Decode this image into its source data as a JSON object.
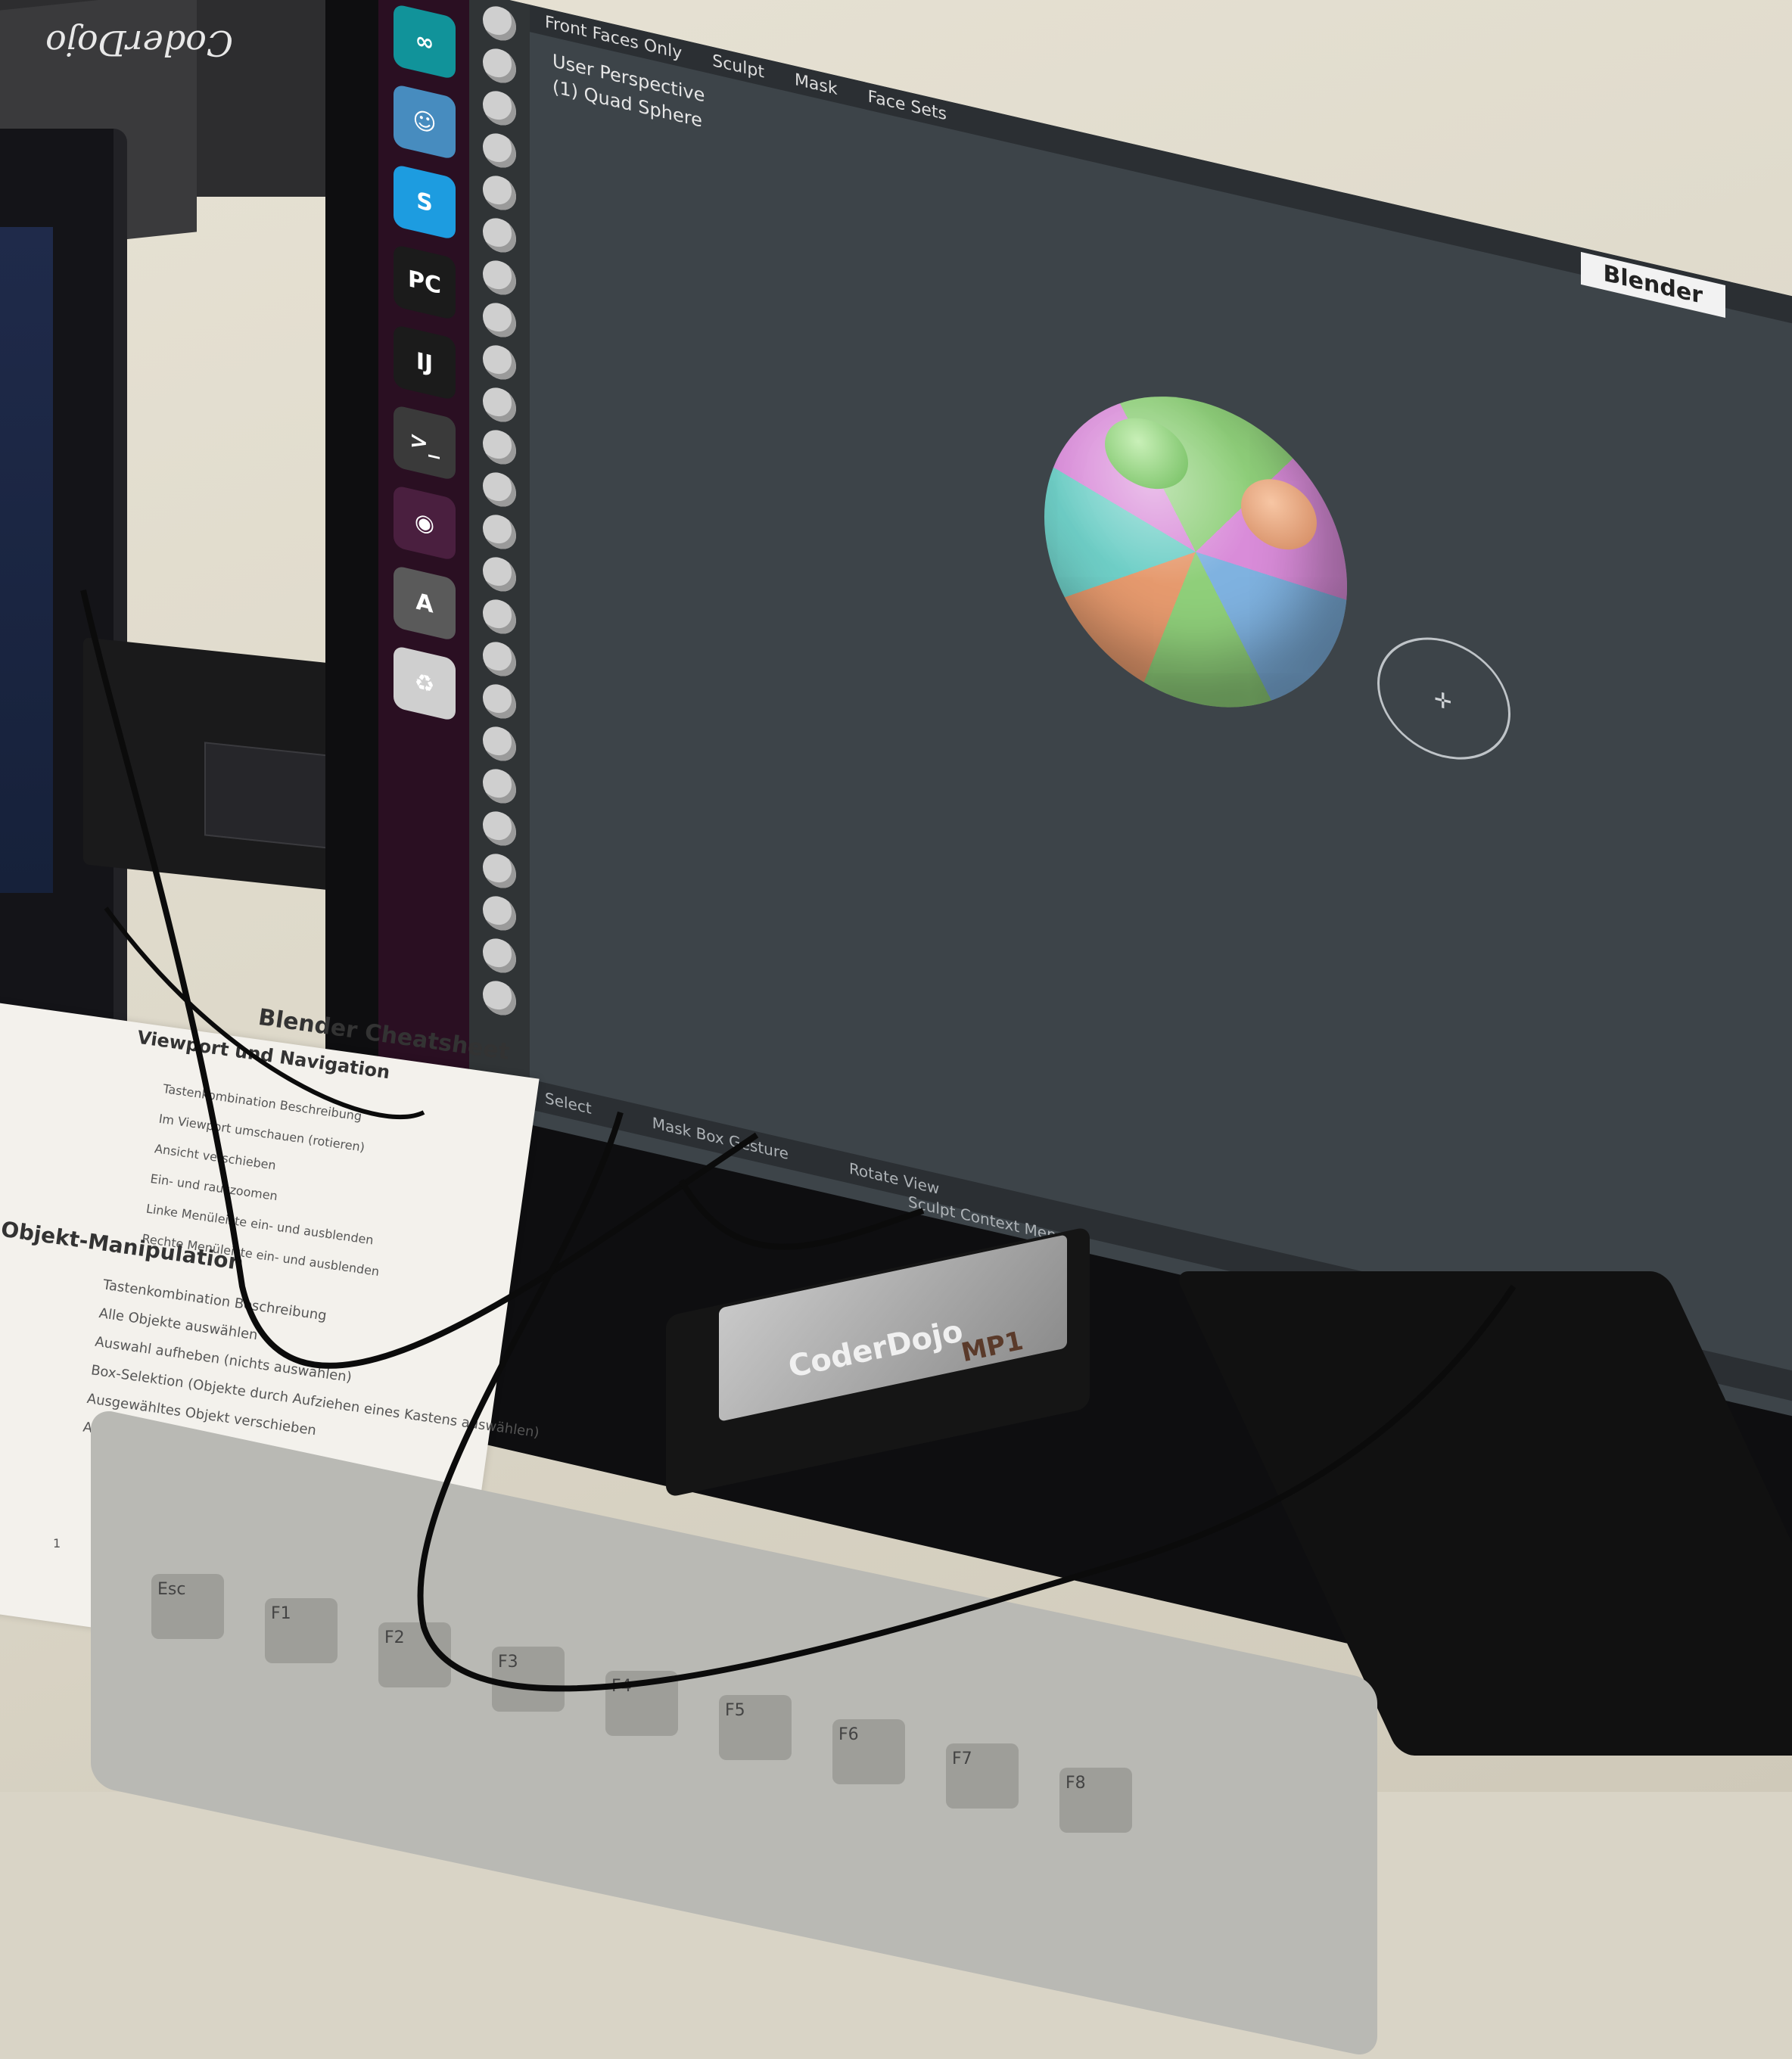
{
  "left_box_label": "CoderDojo",
  "app_title": "Blender",
  "viewport_header": [
    "Front Faces Only",
    "Sculpt",
    "Mask",
    "Face Sets"
  ],
  "view_info": {
    "line1": "User Perspective",
    "line2": "(1) Quad Sphere"
  },
  "status_bar": {
    "select": "Select",
    "mask_box": "Mask Box Gesture",
    "rotate": "Rotate View",
    "context": "Sculpt Context Menu"
  },
  "dock_apps": [
    {
      "label": "∞",
      "name": "arduino-icon",
      "color": "#11939a"
    },
    {
      "label": "☺",
      "name": "godot-icon",
      "color": "#478cbf"
    },
    {
      "label": "S",
      "name": "skype-icon",
      "color": "#1d9ce0"
    },
    {
      "label": "PC",
      "name": "pycharm-icon",
      "color": "#1b1b1b"
    },
    {
      "label": "IJ",
      "name": "intellij-icon",
      "color": "#1b1b1b"
    },
    {
      "label": ">_",
      "name": "terminal-icon",
      "color": "#3a3a3a"
    },
    {
      "label": "◉",
      "name": "blender-icon",
      "color": "#4a1f3f"
    },
    {
      "label": "A",
      "name": "software-updater-icon",
      "color": "#5a5a5a"
    },
    {
      "label": "♻",
      "name": "trash-icon",
      "color": "#cfcfcf"
    }
  ],
  "badge": {
    "brand": "CoderDojo",
    "tag": "MP1"
  },
  "cheatsheet": {
    "title": "Blender Cheatsheet",
    "section1": "Viewport und Navigation",
    "section1_rows": [
      "Tastenkombination   Beschreibung",
      "Im Viewport umschauen (rotieren)",
      "Ansicht verschieben",
      "Ein- und rauszoomen",
      "Linke Menüleiste ein- und ausblenden",
      "Rechte Menüleiste ein- und ausblenden"
    ],
    "section2": "Objekt-Manipulation",
    "section2_rows": [
      "Tastenkombination   Beschreibung",
      "Alle Objekte auswählen",
      "Auswahl aufheben (nichts auswählen)",
      "Box-Selektion (Objekte durch Aufziehen eines Kastens auswählen)",
      "Ausgewähltes Objekt verschieben",
      "Ausgewähltes Objekt skalieren"
    ],
    "page": "1"
  },
  "keyboard_keys": [
    "Esc",
    "F1",
    "F2",
    "F3",
    "F4",
    "F5",
    "F6",
    "F7",
    "F8"
  ]
}
